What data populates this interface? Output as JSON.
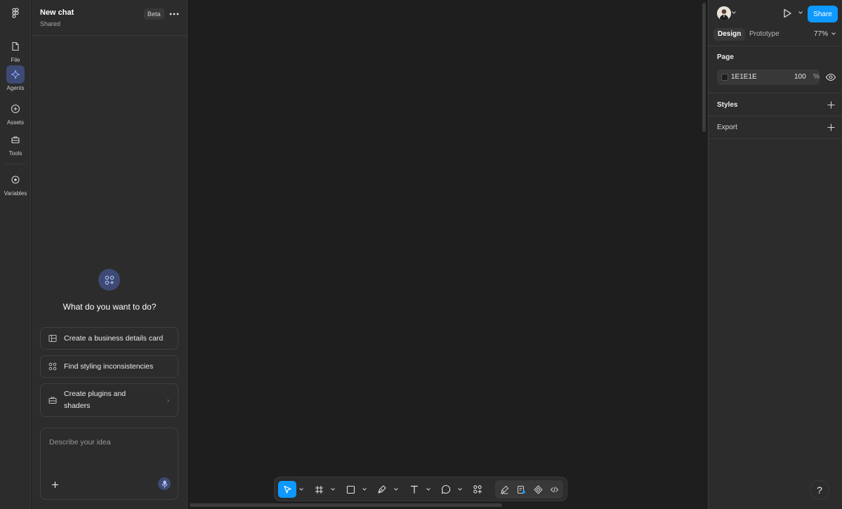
{
  "rail": {
    "items": [
      {
        "label": "File",
        "icon": "file-icon"
      },
      {
        "label": "Agents",
        "icon": "sparkle-icon",
        "active": true
      },
      {
        "label": "Assets",
        "icon": "plus-circle-icon"
      },
      {
        "label": "Tools",
        "icon": "toolbox-icon"
      },
      {
        "label": "Variables",
        "icon": "variables-icon"
      }
    ]
  },
  "chat": {
    "title": "New chat",
    "subtitle": "Shared",
    "badge": "Beta",
    "prompt_title": "What do you want to do?",
    "suggestions": [
      {
        "label": "Create a business details card",
        "icon": "layout-icon"
      },
      {
        "label": "Find styling inconsistencies",
        "icon": "components-icon"
      },
      {
        "label": "Create plugins and shaders",
        "icon": "toolbox-icon"
      }
    ],
    "composer_placeholder": "Describe your idea"
  },
  "right_panel": {
    "share_label": "Share",
    "tabs": [
      "Design",
      "Prototype"
    ],
    "active_tab": "Design",
    "zoom": "77%",
    "page_section": "Page",
    "page_fill_hex": "1E1E1E",
    "page_fill_opacity": "100",
    "page_fill_opacity_unit": "%",
    "styles_section": "Styles",
    "export_section": "Export"
  },
  "toolbar": {
    "tools": [
      "move",
      "frame",
      "rectangle",
      "pen",
      "text",
      "comment",
      "actions"
    ],
    "selected_tool": "move"
  },
  "help_label": "?",
  "colors": {
    "accent": "#0d99ff",
    "agent_active": "#3d4a73",
    "panel": "#2c2c2c",
    "canvas": "#1e1e1e"
  }
}
